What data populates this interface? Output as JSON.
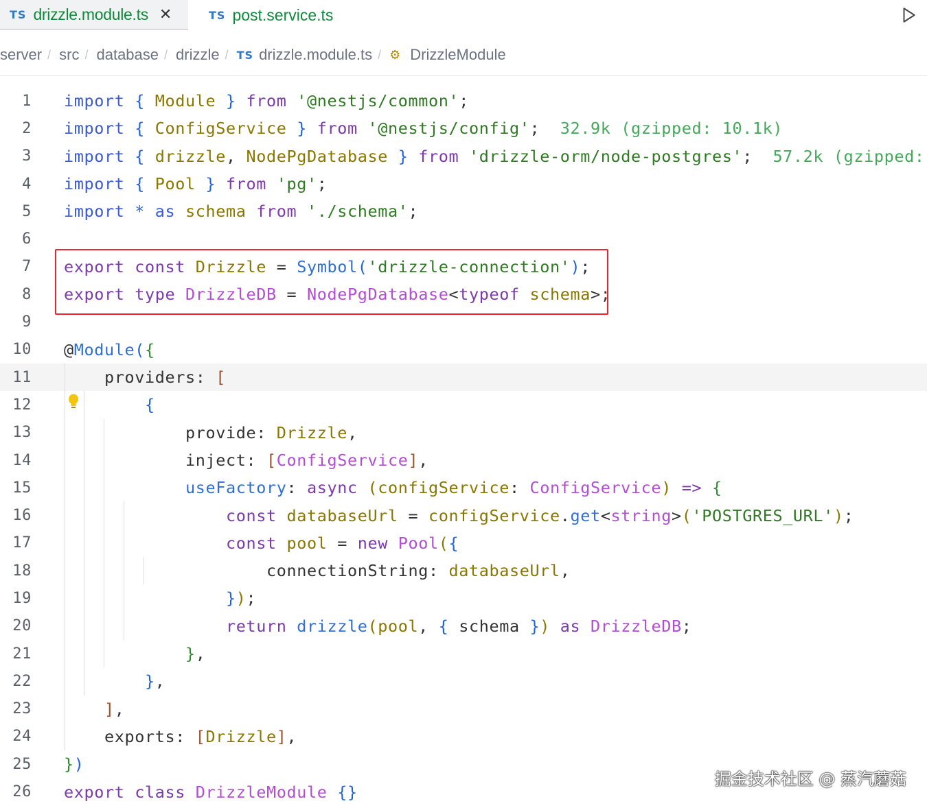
{
  "tabs": [
    {
      "lang": "TS",
      "label": "drizzle.module.ts",
      "close": "✕"
    },
    {
      "lang": "TS",
      "label": "post.service.ts"
    }
  ],
  "breadcrumb": {
    "items": [
      "server",
      "src",
      "database",
      "drizzle"
    ],
    "file_lang": "TS",
    "file": "drizzle.module.ts",
    "symbol": "DrizzleModule"
  },
  "editor": {
    "line_numbers": [
      "1",
      "2",
      "3",
      "4",
      "5",
      "6",
      "7",
      "8",
      "9",
      "10",
      "11",
      "12",
      "13",
      "14",
      "15",
      "16",
      "17",
      "18",
      "19",
      "20",
      "21",
      "22",
      "23",
      "24",
      "25",
      "26"
    ],
    "current_line": 11,
    "hints": {
      "config_size": "32.9k (gzipped: 10.1k)",
      "drizzle_size": "57.2k (gzipped: 1"
    }
  },
  "watermark": "掘金技术社区 @ 蒸汽蘑菇",
  "colors": {
    "highlight_border": "#e8262b",
    "ts_icon": "#3178c6",
    "tab_label": "#0f8a3a"
  }
}
